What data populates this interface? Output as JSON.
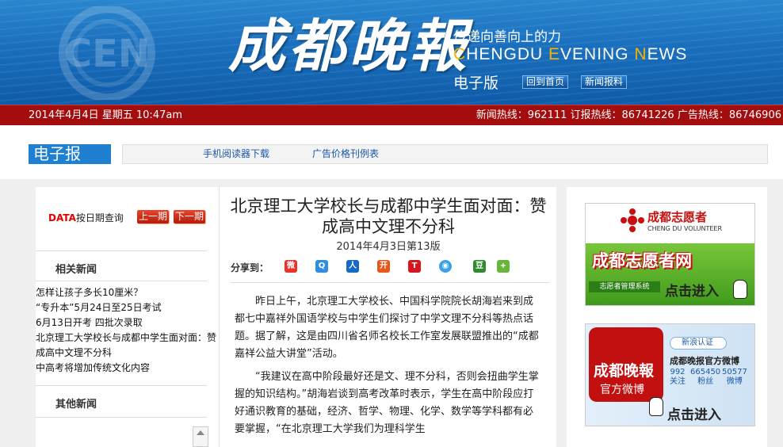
{
  "header": {
    "brand_cn": "成都晚報",
    "slogan": "传递向善向上的力",
    "brand_en_parts": [
      "C",
      "HENGDU ",
      "E",
      "VENING ",
      "N",
      "EWS"
    ],
    "edition": "电子版",
    "btn_home": "回到首页",
    "btn_report": "新闻报料",
    "logo_text": "CEN"
  },
  "infobar": {
    "date": "2014年4月4日 星期五 10:47am",
    "hotlines": "新闻热线：962111 订报热线：86741226 广告热线：86746906"
  },
  "nav": {
    "section_label": "电子报",
    "links": [
      "手机阅读器下载",
      "广告价格刊例表"
    ]
  },
  "sidebar": {
    "data_label": "DATA",
    "date_query": "按日期查询",
    "prev_issue": "上一期",
    "next_issue": "下一期",
    "related_title": "相关新闻",
    "related_news": [
      "怎样让孩子多长10厘米？",
      "“专升本”5月24日至25日考试",
      "6月13日开考 四批次录取",
      "北京理工大学校长与成都中学生面对面：赞成高中文理不分科",
      "中高考将增加传统文化内容"
    ],
    "other_title": "其他新闻"
  },
  "article": {
    "title": "北京理工大学校长与成都中学生面对面：赞成高中文理不分科",
    "date": "2014年4月3日第13版",
    "share_label": "分享到：",
    "share_icons": [
      "weibo-icon",
      "qzone-icon",
      "renren-icon",
      "kaixin-icon",
      "tencent-weibo-icon",
      "douban-circle-icon",
      "douban-icon",
      "more-share-icon"
    ],
    "paragraphs": [
      "昨日上午，北京理工大学校长、中国科学院院长胡海岩来到成都七中嘉祥外国语学校与中学生们探讨了中学文理不分科等热点话题。据了解，这是由四川省名师名校长工作室发展联盟推出的“成都嘉祥公益大讲堂”活动。",
      "“我建议在高中阶段最好还是文、理不分科，否则会扭曲学生掌握的知识结构。”胡海岩谈到高考改革时表示，学生在高中阶段应打好通识教育的基础，经济、哲学、物理、化学、数学等学科都有必要掌握，“在北京理工大学我们为理科学生"
    ]
  },
  "ads": {
    "volunteer": {
      "brand": "成都志愿者",
      "sub": "CHENG DU VOLUNTEER",
      "big": "成都志愿者网",
      "system": "志愿者管理系统",
      "enter": "点击进入"
    },
    "weibo": {
      "logo_cn": "成都晚報",
      "logo_sub": "官方微博",
      "verify": "新浪认证",
      "name": "成都晚报官方微博",
      "stats": [
        {
          "value": "992",
          "label": "关注"
        },
        {
          "value": "665450",
          "label": "粉丝"
        },
        {
          "value": "50577",
          "label": "微博"
        }
      ],
      "enter": "点击进入"
    }
  },
  "colors": {
    "banner_blue": "#1a6fbd",
    "red_bar": "#a30d0d",
    "accent_yellow": "#f4b400",
    "link_blue": "#1a57a8"
  }
}
